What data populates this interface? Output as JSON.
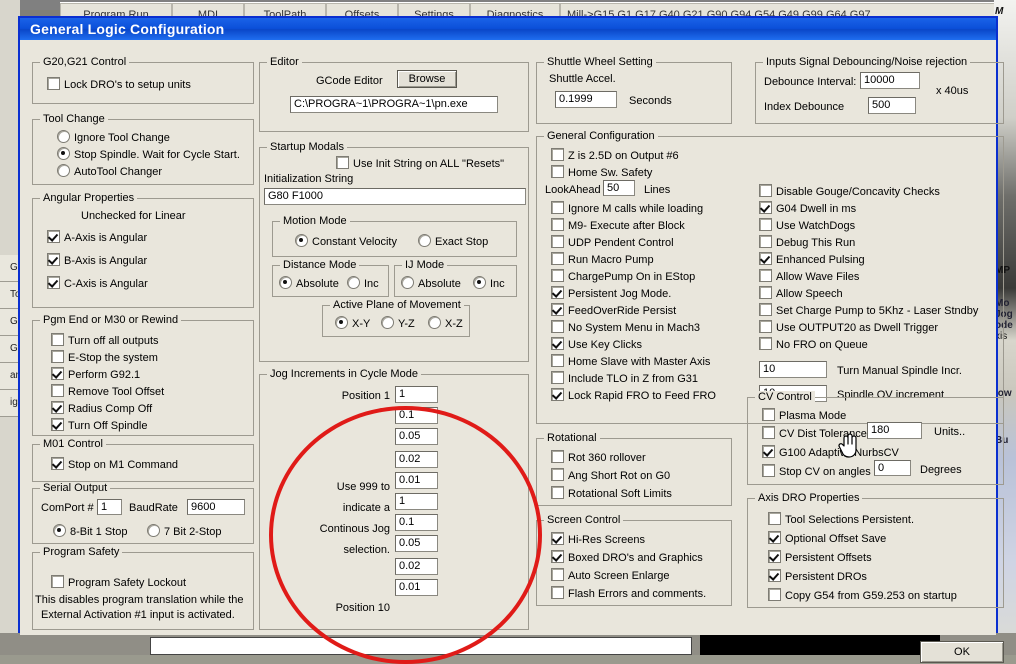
{
  "background": {
    "tabs": [
      "Program Run",
      "MDI",
      "ToolPath",
      "Offsets",
      "Settings",
      "Diagnostics",
      "Mill->G15 G1 G17 G40 G21 G90 G94 G54 G49 G99 G64 G97"
    ],
    "right_panel_labels": [
      "M",
      "MP",
      "Mo",
      "Jog",
      "ode",
      "xis",
      "s",
      "s",
      ".",
      "low",
      "Bu"
    ],
    "left_rows": [
      "G",
      "To",
      "G",
      "G",
      "an",
      "ign"
    ]
  },
  "dialog": {
    "title": "General Logic Configuration",
    "ok_label": "OK"
  },
  "g20_g21": {
    "caption": "G20,G21 Control",
    "items": [
      {
        "label": "Lock DRO's to setup units",
        "checked": false
      }
    ]
  },
  "tool_change": {
    "caption": "Tool Change",
    "options": [
      {
        "label": "Ignore Tool Change",
        "selected": false
      },
      {
        "label": "Stop Spindle. Wait for Cycle Start.",
        "selected": true
      },
      {
        "label": "AutoTool Changer",
        "selected": false
      }
    ]
  },
  "angular": {
    "caption": "Angular Properties",
    "note": "Unchecked for Linear",
    "items": [
      {
        "label": "A-Axis is Angular",
        "checked": true
      },
      {
        "label": "B-Axis is Angular",
        "checked": true
      },
      {
        "label": "C-Axis is Angular",
        "checked": true
      }
    ]
  },
  "pgm_end": {
    "caption": "Pgm End or M30 or Rewind",
    "items": [
      {
        "label": "Turn off all outputs",
        "checked": false
      },
      {
        "label": "E-Stop the system",
        "checked": false
      },
      {
        "label": "Perform G92.1",
        "checked": true
      },
      {
        "label": "Remove Tool Offset",
        "checked": false
      },
      {
        "label": "Radius Comp Off",
        "checked": true
      },
      {
        "label": "Turn Off Spindle",
        "checked": true
      }
    ]
  },
  "m01": {
    "caption": "M01 Control",
    "items": [
      {
        "label": "Stop on M1 Command",
        "checked": true
      }
    ]
  },
  "serial": {
    "caption": "Serial Output",
    "comport_label": "ComPort #",
    "comport_value": "1",
    "baud_label": "BaudRate",
    "baud_value": "9600",
    "options": [
      {
        "label": "8-Bit 1 Stop",
        "selected": true
      },
      {
        "label": "7 Bit 2-Stop",
        "selected": false
      }
    ]
  },
  "program_safety": {
    "caption": "Program Safety",
    "checkbox": {
      "label": "Program Safety Lockout",
      "checked": false
    },
    "note_line1": "This disables program translation while the",
    "note_line2": "External Activation #1 input is activated."
  },
  "editor": {
    "caption": "Editor",
    "gcode_label": "GCode Editor",
    "browse_label": "Browse",
    "path_value": "C:\\PROGRA~1\\PROGRA~1\\pn.exe"
  },
  "startup_modals": {
    "caption": "Startup Modals",
    "use_init": {
      "label": "Use Init String on ALL  \"Resets\"",
      "checked": false
    },
    "init_label": "Initialization String",
    "init_value": "G80 F1000",
    "motion_mode": {
      "caption": "Motion Mode",
      "options": [
        {
          "label": "Constant Velocity",
          "selected": true
        },
        {
          "label": "Exact Stop",
          "selected": false
        }
      ]
    },
    "distance_mode": {
      "caption": "Distance Mode",
      "options": [
        {
          "label": "Absolute",
          "selected": true
        },
        {
          "label": "Inc",
          "selected": false
        }
      ]
    },
    "ij_mode": {
      "caption": "IJ Mode",
      "options": [
        {
          "label": "Absolute",
          "selected": false
        },
        {
          "label": "Inc",
          "selected": true
        }
      ]
    },
    "active_plane": {
      "caption": "Active Plane of Movement",
      "options": [
        {
          "label": "X-Y",
          "selected": true
        },
        {
          "label": "Y-Z",
          "selected": false
        },
        {
          "label": "X-Z",
          "selected": false
        }
      ]
    }
  },
  "jog_increments": {
    "caption": "Jog Increments in Cycle Mode",
    "first_label": "Position 1",
    "last_label": "Position 10",
    "hint_lines": [
      "Use 999 to",
      "indicate a",
      "Continous Jog",
      "selection."
    ],
    "values": [
      "1",
      "0.1",
      "0.05",
      "0.02",
      "0.01",
      "1",
      "0.1",
      "0.05",
      "0.02",
      "0.01"
    ]
  },
  "shuttle": {
    "caption": "Shuttle Wheel Setting",
    "accel_label": "Shuttle Accel.",
    "accel_value": "0.1999",
    "seconds_label": "Seconds"
  },
  "general_config": {
    "caption": "General Configuration",
    "items_left": [
      {
        "label": "Z is 2.5D on Output #6",
        "checked": false
      },
      {
        "label": "Home Sw. Safety",
        "checked": false
      }
    ],
    "lookahead_label": "LookAhead",
    "lookahead_value": "50",
    "lines_label": "Lines",
    "items_left2": [
      {
        "label": "Ignore M calls while loading",
        "checked": false
      },
      {
        "label": "M9- Execute after Block",
        "checked": false
      },
      {
        "label": "UDP Pendent Control",
        "checked": false
      },
      {
        "label": "Run Macro Pump",
        "checked": false
      },
      {
        "label": "ChargePump On in EStop",
        "checked": false
      },
      {
        "label": "Persistent Jog Mode.",
        "checked": true
      },
      {
        "label": "FeedOverRide Persist",
        "checked": true
      },
      {
        "label": "No System Menu in Mach3",
        "checked": false
      },
      {
        "label": "Use Key Clicks",
        "checked": true
      },
      {
        "label": "Home Slave with Master Axis",
        "checked": false
      },
      {
        "label": "Include TLO in Z from G31",
        "checked": false
      },
      {
        "label": "Lock Rapid FRO to Feed FRO",
        "checked": true
      }
    ],
    "items_right": [
      {
        "label": "Disable Gouge/Concavity Checks",
        "checked": false
      },
      {
        "label": "G04 Dwell in ms",
        "checked": true
      },
      {
        "label": "Use WatchDogs",
        "checked": false
      },
      {
        "label": "Debug This Run",
        "checked": false
      },
      {
        "label": "Enhanced Pulsing",
        "checked": true
      },
      {
        "label": "Allow Wave Files",
        "checked": false
      },
      {
        "label": "Allow Speech",
        "checked": false
      },
      {
        "label": "Set Charge Pump to 5Khz  - Laser Stndby",
        "checked": false
      },
      {
        "label": "Use OUTPUT20 as Dwell Trigger",
        "checked": false
      },
      {
        "label": "No FRO on Queue",
        "checked": false
      }
    ],
    "spindle_incr_value": "10",
    "spindle_incr_label": "Turn Manual Spindle Incr.",
    "spindle_ov_value": "10",
    "spindle_ov_label": "Spindle OV increment"
  },
  "rotational": {
    "caption": "Rotational",
    "items": [
      {
        "label": "Rot 360 rollover",
        "checked": false
      },
      {
        "label": "Ang Short Rot on G0",
        "checked": false
      },
      {
        "label": "Rotational Soft Limits",
        "checked": false
      }
    ]
  },
  "screen_control": {
    "caption": "Screen Control",
    "items": [
      {
        "label": "Hi-Res Screens",
        "checked": true
      },
      {
        "label": "Boxed DRO's and Graphics",
        "checked": true
      },
      {
        "label": "Auto Screen Enlarge",
        "checked": false
      },
      {
        "label": "Flash Errors and comments.",
        "checked": false
      }
    ]
  },
  "debouncing": {
    "caption": "Inputs Signal Debouncing/Noise rejection",
    "debounce_label": "Debounce Interval:",
    "debounce_value": "10000",
    "index_label": "Index Debounce",
    "index_value": "500",
    "units_label": "x 40us"
  },
  "cv_control": {
    "caption": "CV Control",
    "plasma": {
      "label": "Plasma Mode",
      "checked": false
    },
    "cv_dist": {
      "label": "CV Dist Tolerance",
      "checked": false
    },
    "cv_dist_value": "180",
    "units_label": "Units..",
    "nurbs": {
      "label": "G100 Adaptive NurbsCV",
      "checked": true
    },
    "stop_cv": {
      "label": "Stop CV on angles >",
      "checked": false
    },
    "stop_cv_value": "0",
    "degrees_label": "Degrees"
  },
  "axis_dro": {
    "caption": "Axis DRO Properties",
    "items": [
      {
        "label": "Tool Selections Persistent.",
        "checked": false
      },
      {
        "label": "Optional Offset Save",
        "checked": true
      },
      {
        "label": "Persistent Offsets",
        "checked": true
      },
      {
        "label": "Persistent DROs",
        "checked": true
      },
      {
        "label": "Copy G54 from G59.253 on startup",
        "checked": false
      }
    ]
  },
  "annotation": {
    "shape": "red-ellipse",
    "color": "#e01b18"
  }
}
